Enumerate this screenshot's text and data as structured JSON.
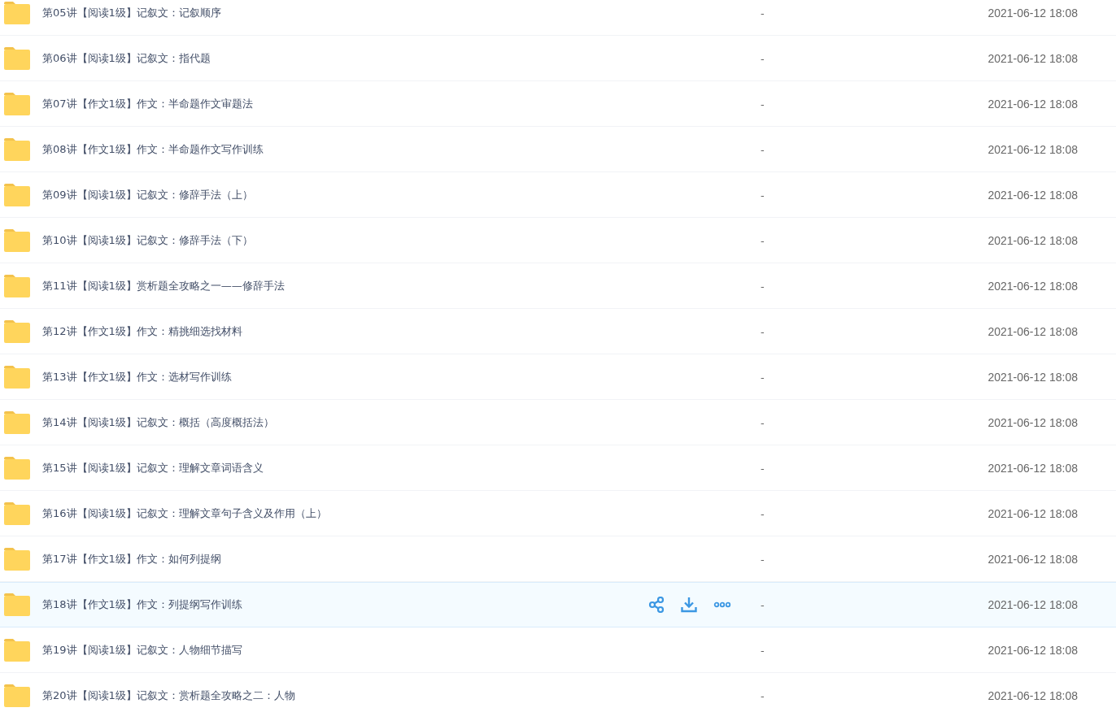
{
  "files": [
    {
      "name": "第05讲【阅读1级】记叙文：记叙顺序",
      "size": "-",
      "modified": "2021-06-12 18:08",
      "hovered": false
    },
    {
      "name": "第06讲【阅读1级】记叙文：指代题",
      "size": "-",
      "modified": "2021-06-12 18:08",
      "hovered": false
    },
    {
      "name": "第07讲【作文1级】作文：半命题作文审题法",
      "size": "-",
      "modified": "2021-06-12 18:08",
      "hovered": false
    },
    {
      "name": "第08讲【作文1级】作文：半命题作文写作训练",
      "size": "-",
      "modified": "2021-06-12 18:08",
      "hovered": false
    },
    {
      "name": "第09讲【阅读1级】记叙文：修辞手法（上）",
      "size": "-",
      "modified": "2021-06-12 18:08",
      "hovered": false
    },
    {
      "name": "第10讲【阅读1级】记叙文：修辞手法（下）",
      "size": "-",
      "modified": "2021-06-12 18:08",
      "hovered": false
    },
    {
      "name": "第11讲【阅读1级】赏析题全攻略之一——修辞手法",
      "size": "-",
      "modified": "2021-06-12 18:08",
      "hovered": false
    },
    {
      "name": "第12讲【作文1级】作文：精挑细选找材料",
      "size": "-",
      "modified": "2021-06-12 18:08",
      "hovered": false
    },
    {
      "name": "第13讲【作文1级】作文：选材写作训练",
      "size": "-",
      "modified": "2021-06-12 18:08",
      "hovered": false
    },
    {
      "name": "第14讲【阅读1级】记叙文：概括（高度概括法）",
      "size": "-",
      "modified": "2021-06-12 18:08",
      "hovered": false
    },
    {
      "name": "第15讲【阅读1级】记叙文：理解文章词语含义",
      "size": "-",
      "modified": "2021-06-12 18:08",
      "hovered": false
    },
    {
      "name": "第16讲【阅读1级】记叙文：理解文章句子含义及作用（上）",
      "size": "-",
      "modified": "2021-06-12 18:08",
      "hovered": false
    },
    {
      "name": "第17讲【作文1级】作文：如何列提纲",
      "size": "-",
      "modified": "2021-06-12 18:08",
      "hovered": false
    },
    {
      "name": "第18讲【作文1级】作文：列提纲写作训练",
      "size": "-",
      "modified": "2021-06-12 18:08",
      "hovered": true
    },
    {
      "name": "第19讲【阅读1级】记叙文：人物细节描写",
      "size": "-",
      "modified": "2021-06-12 18:08",
      "hovered": false
    },
    {
      "name": "第20讲【阅读1级】记叙文：赏析题全攻略之二：人物",
      "size": "-",
      "modified": "2021-06-12 18:08",
      "hovered": false
    }
  ]
}
